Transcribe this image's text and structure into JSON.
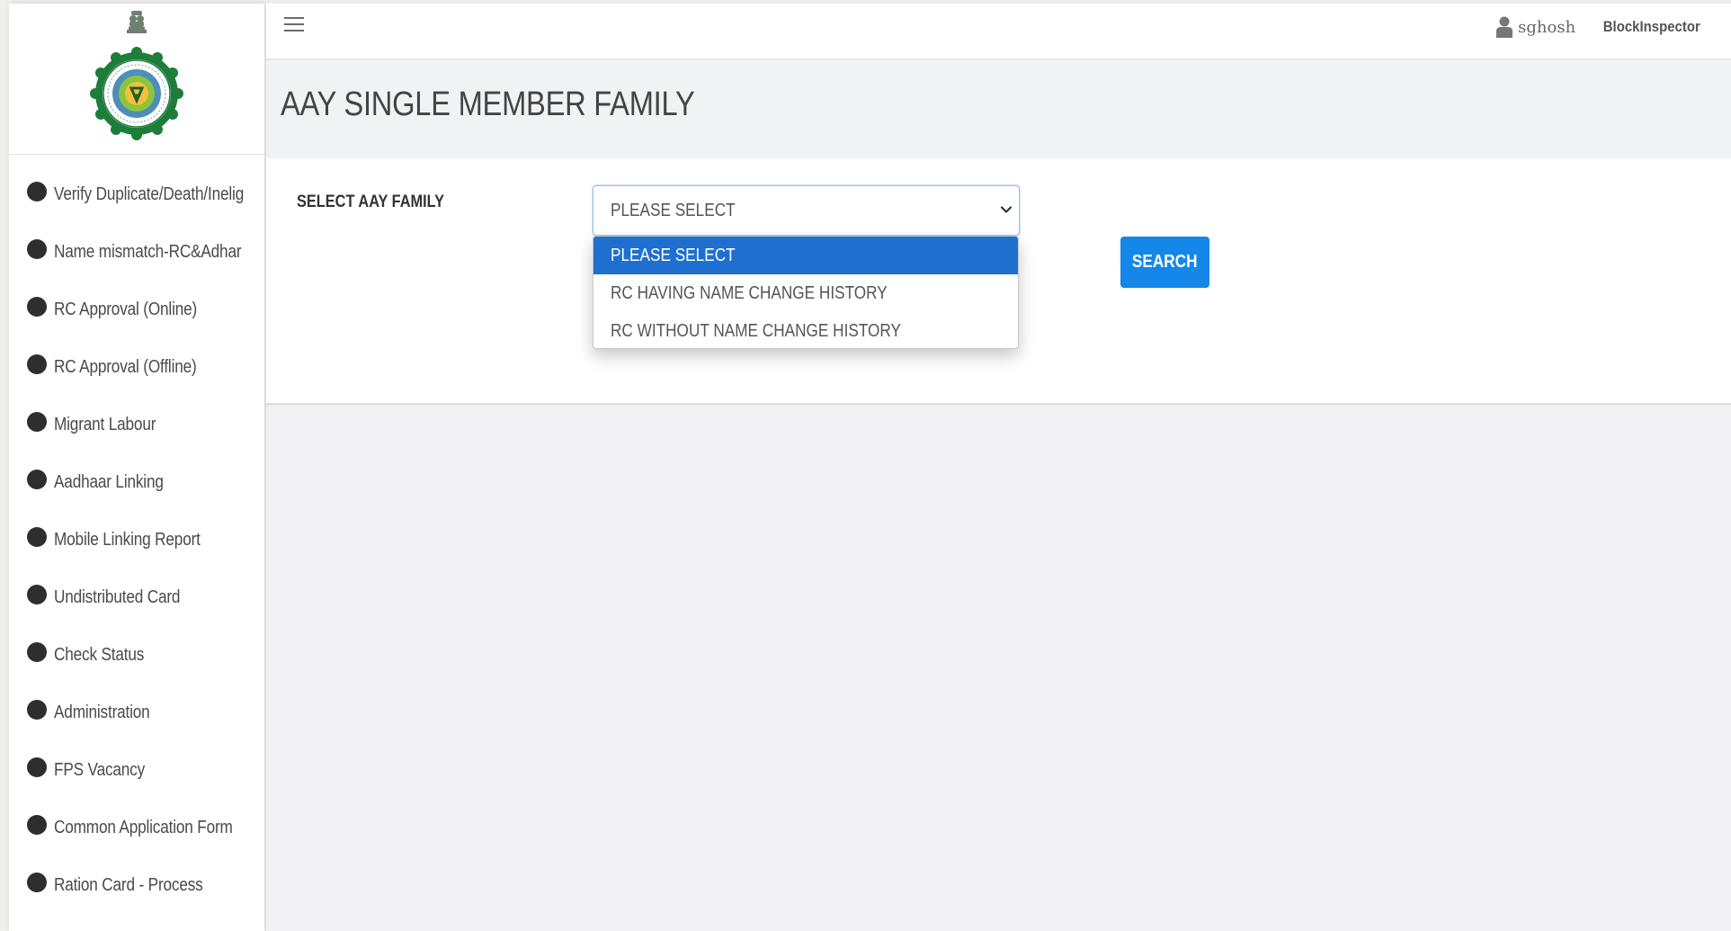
{
  "header": {
    "user_name": "sghosh",
    "user_role": "BlockInspector"
  },
  "sidebar": {
    "items": [
      {
        "label": "Verify Duplicate/Death/Inelig"
      },
      {
        "label": "Name mismatch-RC&Adhar"
      },
      {
        "label": "RC Approval (Online)"
      },
      {
        "label": "RC Approval (Offline)"
      },
      {
        "label": "Migrant Labour"
      },
      {
        "label": "Aadhaar Linking"
      },
      {
        "label": "Mobile Linking Report"
      },
      {
        "label": "Undistributed Card"
      },
      {
        "label": "Check Status"
      },
      {
        "label": "Administration"
      },
      {
        "label": "FPS Vacancy"
      },
      {
        "label": "Common Application Form"
      },
      {
        "label": "Ration Card - Process"
      }
    ]
  },
  "page": {
    "title": "AAY SINGLE MEMBER FAMILY"
  },
  "form": {
    "label": "SELECT AAY FAMILY",
    "selected_value": "PLEASE SELECT",
    "options": [
      {
        "label": "PLEASE SELECT",
        "selected": true
      },
      {
        "label": "RC HAVING NAME CHANGE HISTORY",
        "selected": false
      },
      {
        "label": "RC WITHOUT NAME CHANGE HISTORY",
        "selected": false
      }
    ],
    "search_label": "SEARCH"
  },
  "colors": {
    "accent": "#1487e8",
    "selected_option": "#1e6fd0",
    "bullet": "#2e2e2e",
    "logo_green": "#1e7d3a"
  },
  "icons": {
    "menu": "hamburger-icon",
    "user": "user-icon",
    "dropdown": "chevron-down-icon",
    "bullet": "bullet-icon",
    "logo": "state-emblem-logo"
  }
}
